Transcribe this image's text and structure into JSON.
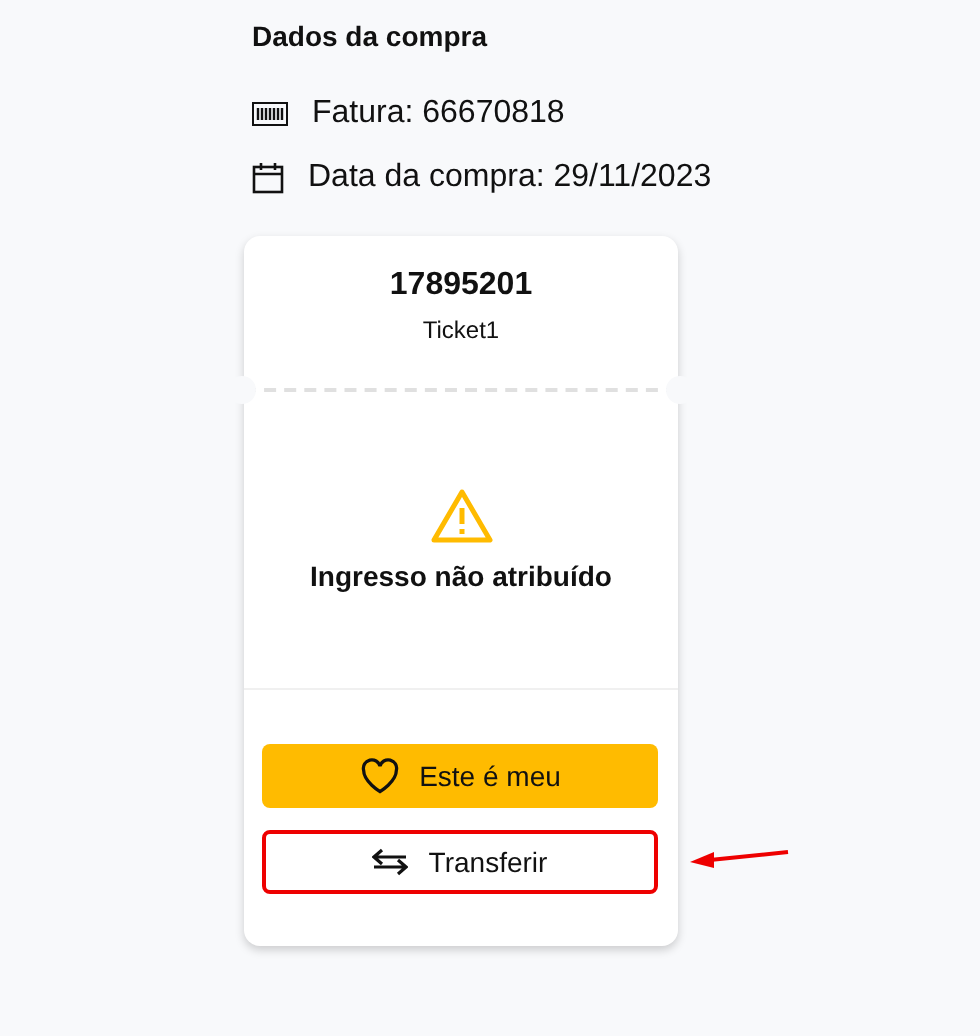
{
  "section_title": "Dados da compra",
  "details": [
    {
      "kind": "invoice",
      "text": "Fatura: 66670818"
    },
    {
      "kind": "date",
      "text": "Data da compra: 29/11/2023"
    }
  ],
  "ticket": {
    "number": "17895201",
    "name": "Ticket1",
    "status": "Ingresso não atribuído",
    "buttons": [
      {
        "kind": "claim",
        "label": "Este é meu",
        "highlighted": false
      },
      {
        "kind": "transfer",
        "label": "Transferir",
        "highlighted": true
      }
    ]
  }
}
